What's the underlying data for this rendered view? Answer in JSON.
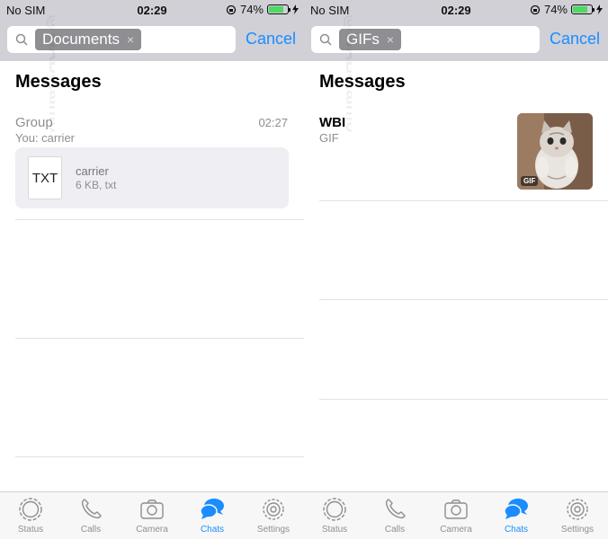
{
  "left_panel": {
    "status": {
      "carrier": "No SIM",
      "time": "02:29",
      "battery": "74%",
      "battery_level": 0.74
    },
    "search": {
      "token": "Documents",
      "token_clear": "×",
      "cancel": "Cancel"
    },
    "section_title": "Messages",
    "result": {
      "chat_name": "Group",
      "preview": "You: carrier",
      "time": "02:27",
      "doc_type": "TXT",
      "doc_name": "carrier",
      "doc_meta": "6 KB, txt"
    },
    "tabs": [
      {
        "label": "Status",
        "icon": "status-icon"
      },
      {
        "label": "Calls",
        "icon": "phone-icon"
      },
      {
        "label": "Camera",
        "icon": "camera-icon"
      },
      {
        "label": "Chats",
        "icon": "chats-icon",
        "active": true
      },
      {
        "label": "Settings",
        "icon": "gear-icon"
      }
    ]
  },
  "right_panel": {
    "status": {
      "carrier": "No SIM",
      "time": "02:29",
      "battery": "74%",
      "battery_level": 0.74
    },
    "search": {
      "token": "GIFs",
      "token_clear": "×",
      "cancel": "Cancel"
    },
    "section_title": "Messages",
    "result": {
      "chat_name": "WBI",
      "subtitle": "GIF",
      "badge": "GIF"
    },
    "tabs": [
      {
        "label": "Status",
        "icon": "status-icon"
      },
      {
        "label": "Calls",
        "icon": "phone-icon"
      },
      {
        "label": "Camera",
        "icon": "camera-icon"
      },
      {
        "label": "Chats",
        "icon": "chats-icon",
        "active": true
      },
      {
        "label": "Settings",
        "icon": "gear-icon"
      }
    ]
  },
  "watermark": "@WABetaInfo",
  "colors": {
    "accent": "#1a8cff",
    "search_bar_bg": "#d0d0d6",
    "token_bg": "#8e8e93",
    "battery_green": "#4cd964"
  }
}
